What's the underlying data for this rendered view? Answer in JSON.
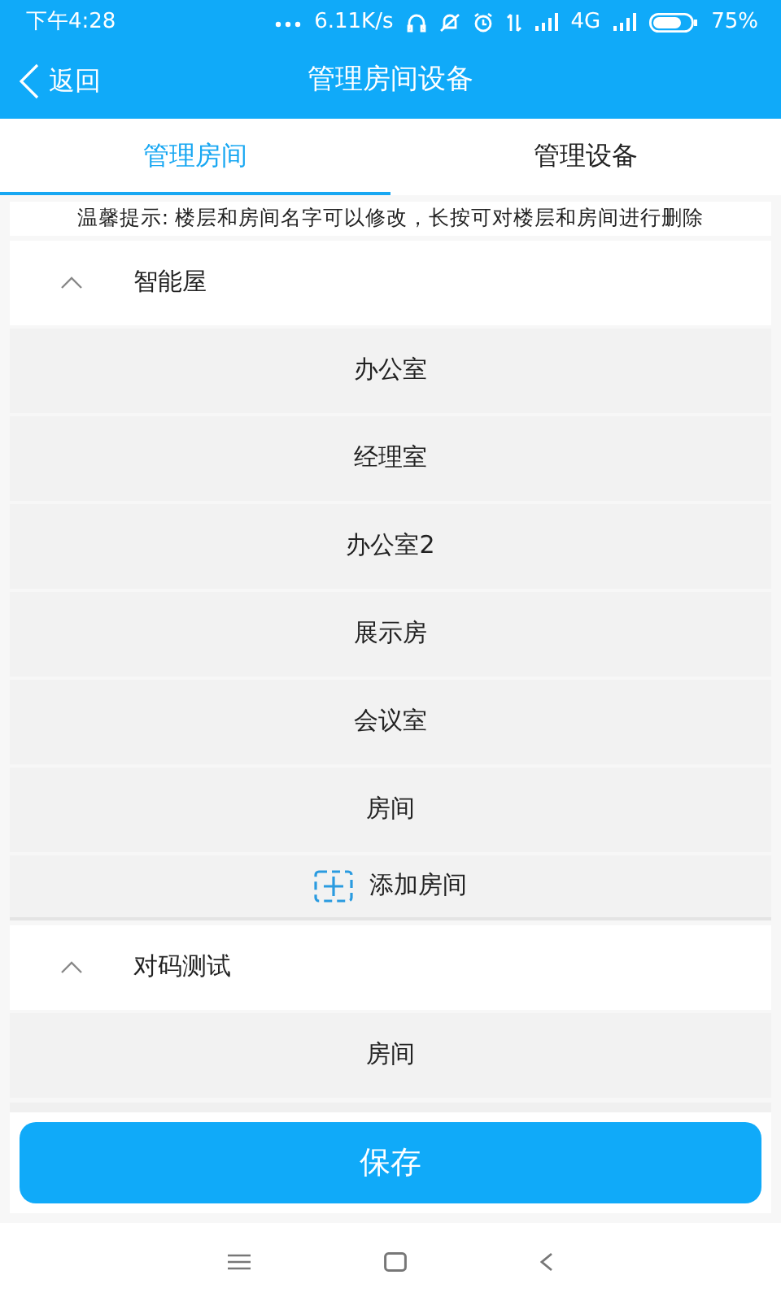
{
  "status_bar": {
    "time": "下午4:28",
    "speed": "6.11K/s",
    "network": "4G",
    "battery": "75%"
  },
  "header": {
    "back": "返回",
    "title": "管理房间设备"
  },
  "tabs": [
    {
      "label": "管理房间",
      "selected": true
    },
    {
      "label": "管理设备",
      "selected": false
    }
  ],
  "hint": "温馨提示: 楼层和房间名字可以修改，长按可对楼层和房间进行删除",
  "floors": [
    {
      "name": "智能屋",
      "expanded": true,
      "rooms": [
        "办公室",
        "经理室",
        "办公室2",
        "展示房",
        "会议室",
        "房间"
      ],
      "add_label": "添加房间"
    },
    {
      "name": "对码测试",
      "expanded": true,
      "rooms": [
        "房间"
      ]
    }
  ],
  "save_button": "保存"
}
